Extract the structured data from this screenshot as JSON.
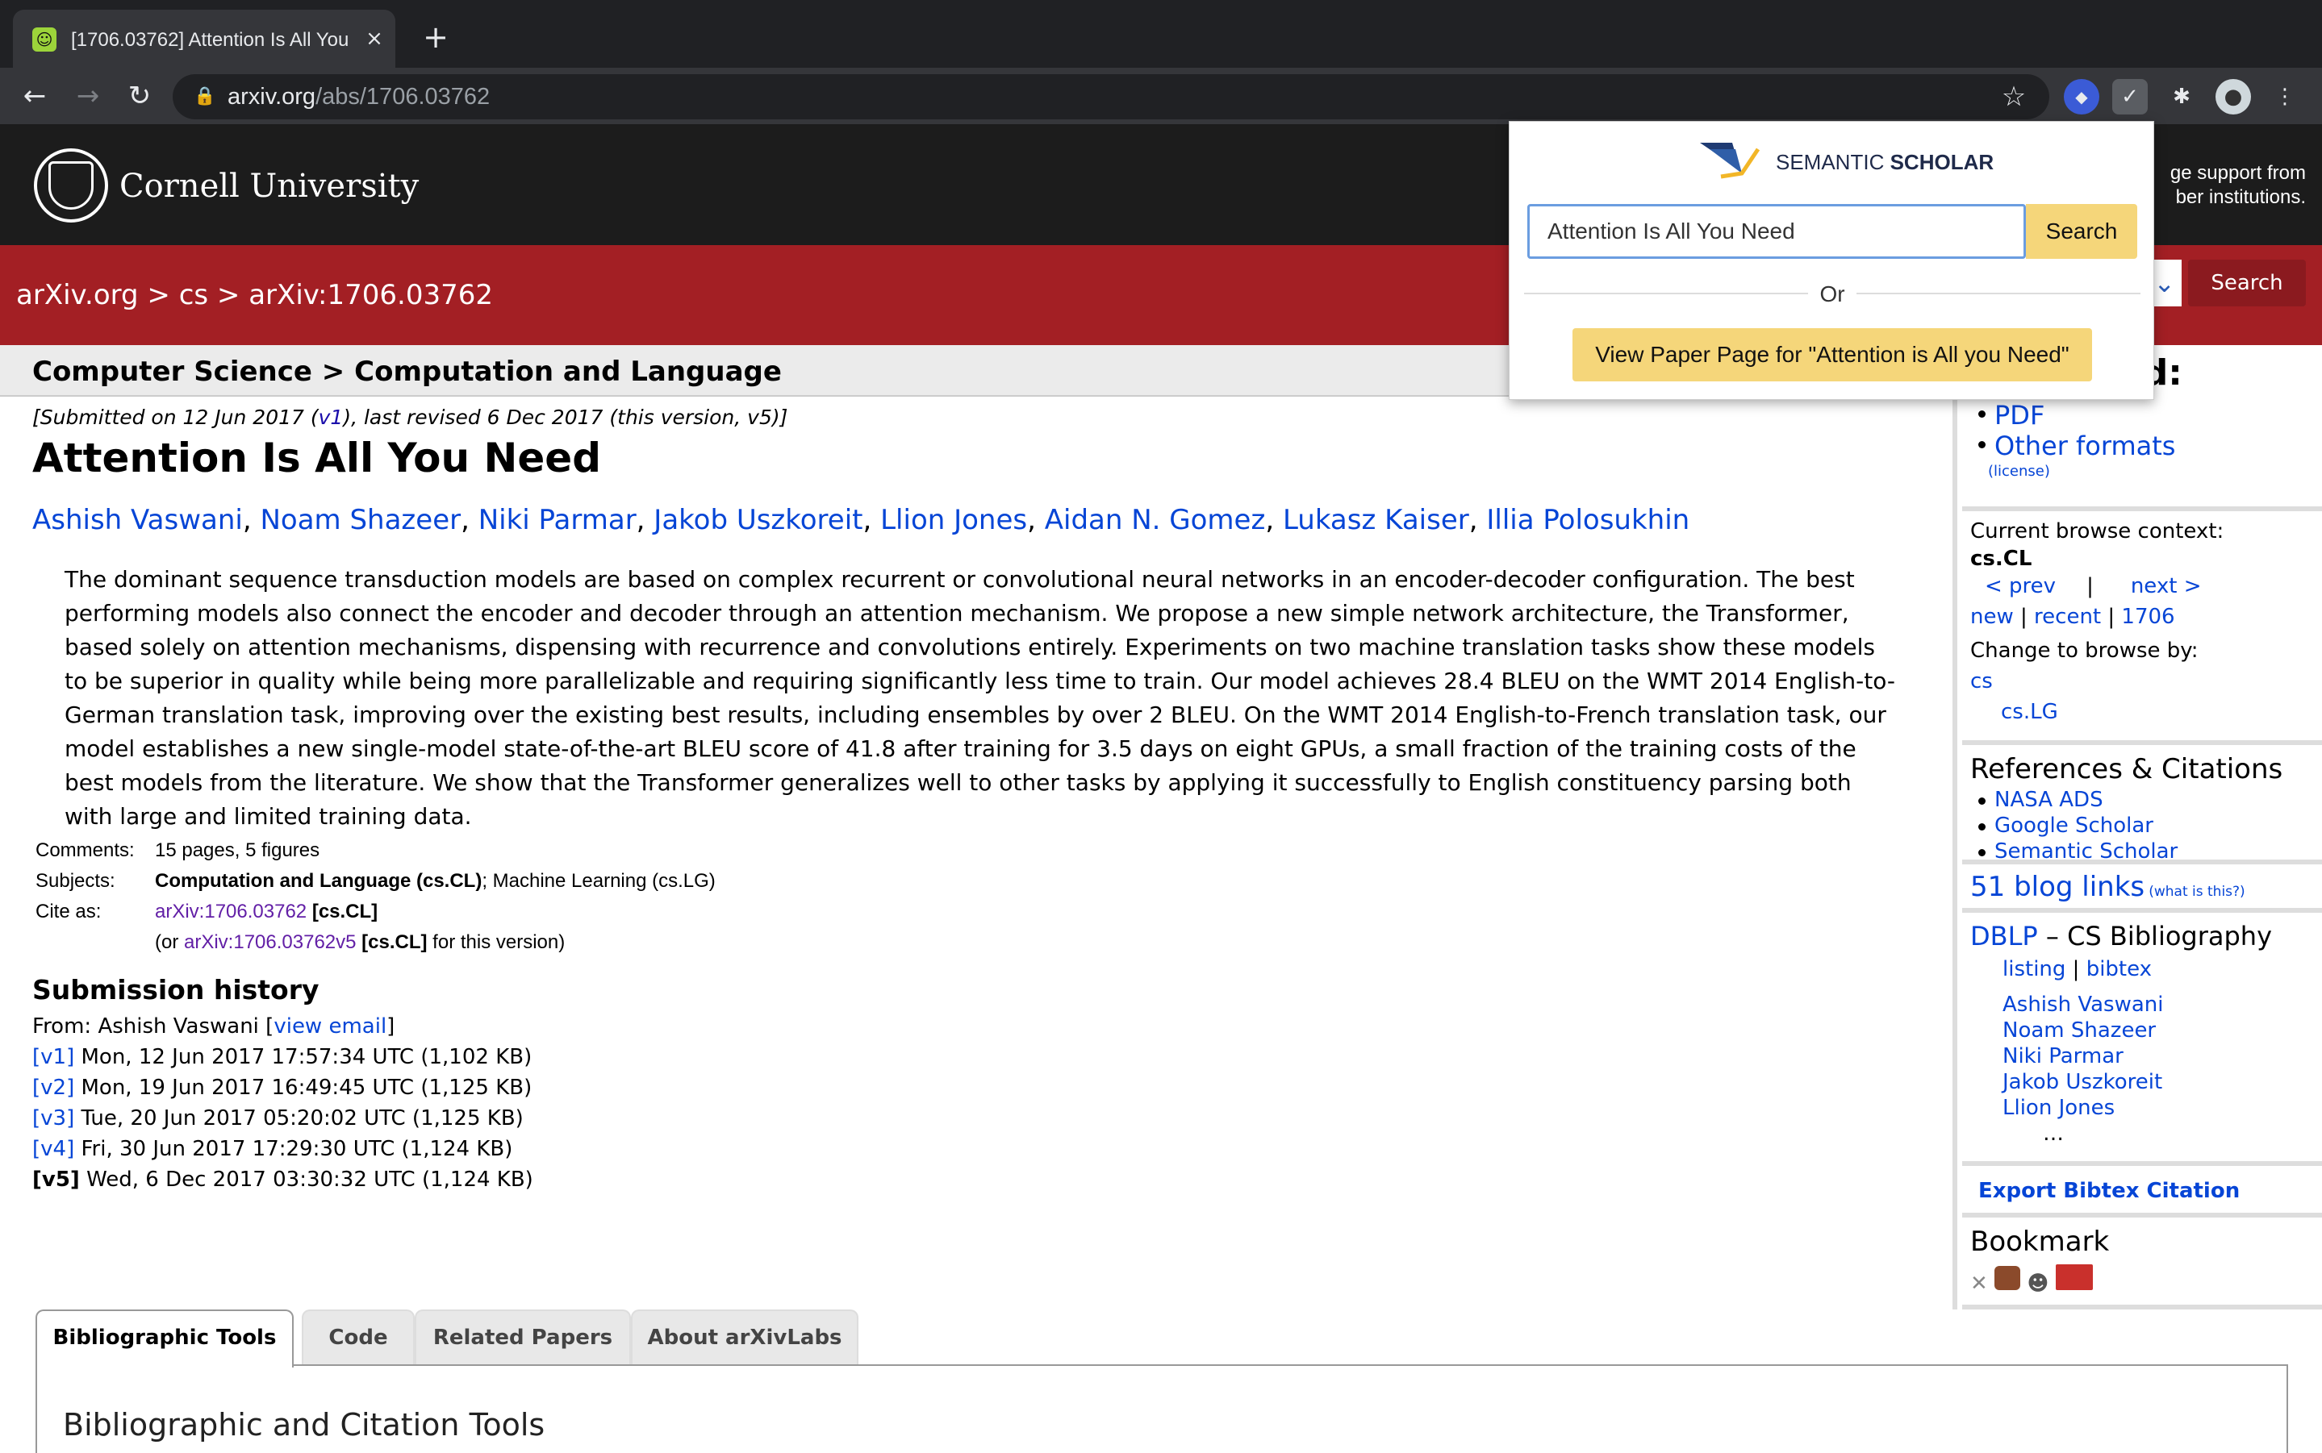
{
  "browser": {
    "tab_title": "[1706.03762] Attention Is All You Need",
    "url_host": "arxiv.org",
    "url_path": "/abs/1706.03762",
    "close": "×",
    "newtab": "+",
    "back": "←",
    "forward": "→",
    "reload": "↻",
    "star": "☆",
    "menu": "⋮"
  },
  "cornell": {
    "name": "Cornell University",
    "support_line1": "ge support from",
    "support_line2": "ber institutions."
  },
  "redbar": {
    "breadcrumb": "arXiv.org > cs > arXiv:1706.03762",
    "search_label": "Search"
  },
  "subject_header": "Computer Science > Computation and Language",
  "paper": {
    "dateline_pre": "[Submitted on 12 Jun 2017 (",
    "dateline_v1": "v1",
    "dateline_post": "), last revised 6 Dec 2017 (this version, v5)]",
    "title": "Attention Is All You Need",
    "authors": [
      "Ashish Vaswani",
      "Noam Shazeer",
      "Niki Parmar",
      "Jakob Uszkoreit",
      "Llion Jones",
      "Aidan N. Gomez",
      "Lukasz Kaiser",
      "Illia Polosukhin"
    ],
    "abstract": "The dominant sequence transduction models are based on complex recurrent or convolutional neural networks in an encoder-decoder configuration. The best performing models also connect the encoder and decoder through an attention mechanism. We propose a new simple network architecture, the Transformer, based solely on attention mechanisms, dispensing with recurrence and convolutions entirely. Experiments on two machine translation tasks show these models to be superior in quality while being more parallelizable and requiring significantly less time to train. Our model achieves 28.4 BLEU on the WMT 2014 English-to-German translation task, improving over the existing best results, including ensembles by over 2 BLEU. On the WMT 2014 English-to-French translation task, our model establishes a new single-model state-of-the-art BLEU score of 41.8 after training for 3.5 days on eight GPUs, a small fraction of the training costs of the best models from the literature. We show that the Transformer generalizes well to other tasks by applying it successfully to English constituency parsing both with large and limited training data."
  },
  "meta": {
    "comments_label": "Comments:",
    "comments": "15 pages, 5 figures",
    "subjects_label": "Subjects:",
    "subjects_bold": "Computation and Language (cs.CL)",
    "subjects_rest": "; Machine Learning (cs.LG)",
    "cite_label": "Cite as:",
    "cite_link": "arXiv:1706.03762",
    "cite_tag": "[cs.CL]",
    "cite2_pre": "(or ",
    "cite2_link": "arXiv:1706.03762v5",
    "cite2_tag": "[cs.CL]",
    "cite2_post": " for this version)"
  },
  "history": {
    "heading": "Submission history",
    "from_pre": "From: Ashish Vaswani [",
    "from_link": "view email",
    "from_post": "]",
    "versions": [
      {
        "v": "[v1]",
        "text": "Mon, 12 Jun 2017 17:57:34 UTC (1,102 KB)"
      },
      {
        "v": "[v2]",
        "text": "Mon, 19 Jun 2017 16:49:45 UTC (1,125 KB)"
      },
      {
        "v": "[v3]",
        "text": "Tue, 20 Jun 2017 05:20:02 UTC (1,125 KB)"
      },
      {
        "v": "[v4]",
        "text": "Fri, 30 Jun 2017 17:29:30 UTC (1,124 KB)"
      },
      {
        "v": "[v5]",
        "text": "Wed, 6 Dec 2017 03:30:32 UTC (1,124 KB)"
      }
    ]
  },
  "sidebar": {
    "download": "Download:",
    "pdf": "PDF",
    "other": "Other formats",
    "license": "(license)",
    "context_label": "Current browse context:",
    "context": "cs.CL",
    "prev": "< prev",
    "sep": "|",
    "next": "next >",
    "new": "new",
    "recent": "recent",
    "month": "1706",
    "change_label": "Change to browse by:",
    "cs": "cs",
    "cslg": "cs.LG",
    "refs_heading": "References & Citations",
    "refs": [
      "NASA ADS",
      "Google Scholar",
      "Semantic Scholar"
    ],
    "blog": "51 blog links",
    "blog_what": "(what is this?)",
    "dblp": "DBLP",
    "dblp_rest": " – CS Bibliography",
    "listing": "listing",
    "bibtex": "bibtex",
    "dblp_authors": [
      "Ashish Vaswani",
      "Noam Shazeer",
      "Niki Parmar",
      "Jakob Uszkoreit",
      "Llion Jones"
    ],
    "ellipsis": "…",
    "export": "Export Bibtex Citation",
    "bookmark": "Bookmark"
  },
  "tabs": {
    "items": [
      "Bibliographic Tools",
      "Code",
      "Related Papers",
      "About arXivLabs"
    ],
    "heading": "Bibliographic and Citation Tools"
  },
  "popup": {
    "brand1": "SEMANTIC ",
    "brand2": "SCHOLAR",
    "query": "Attention Is All You Need",
    "search": "Search",
    "or": "Or",
    "view": "View Paper Page for \"Attention is All you Need\""
  }
}
